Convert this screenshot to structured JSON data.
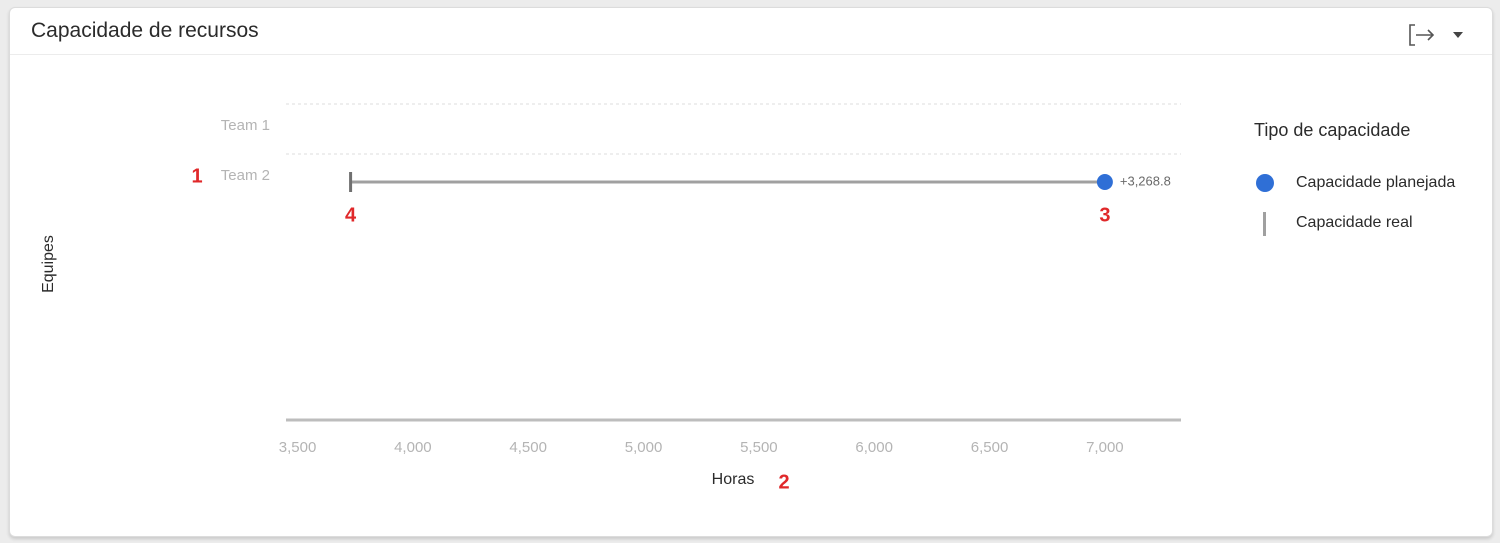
{
  "header": {
    "title": "Capacidade de recursos"
  },
  "colors": {
    "planned": "#2f6fd6",
    "actual": "#a0a0a0",
    "annotation": "#e0282a"
  },
  "chart_data": {
    "type": "dumbbell",
    "title": "Capacidade de recursos",
    "xlabel": "Horas",
    "ylabel": "Equipes",
    "xlim": [
      3450,
      7330
    ],
    "xticks": [
      3500,
      4000,
      4500,
      5000,
      5500,
      6000,
      6500,
      7000
    ],
    "xtick_labels": [
      "3,500",
      "4,000",
      "4,500",
      "5,000",
      "5,500",
      "6,000",
      "6,500",
      "7,000"
    ],
    "categories": [
      "Team 1",
      "Team 2"
    ],
    "series": [
      {
        "name": "Capacidade planejada",
        "marker": "dot",
        "values": [
          null,
          7000
        ]
      },
      {
        "name": "Capacidade real",
        "marker": "bar",
        "values": [
          null,
          3730
        ]
      }
    ],
    "data_labels": [
      {
        "category": "Team 2",
        "text": "+3,268.8"
      }
    ],
    "grid": true,
    "legend": {
      "title": "Tipo de capacidade",
      "position": "right"
    },
    "annotations": [
      {
        "text": "1",
        "target": "Team 2 label"
      },
      {
        "text": "2",
        "target": "x-axis title"
      },
      {
        "text": "3",
        "target": "planned capacity point"
      },
      {
        "text": "4",
        "target": "actual capacity marker"
      }
    ]
  }
}
